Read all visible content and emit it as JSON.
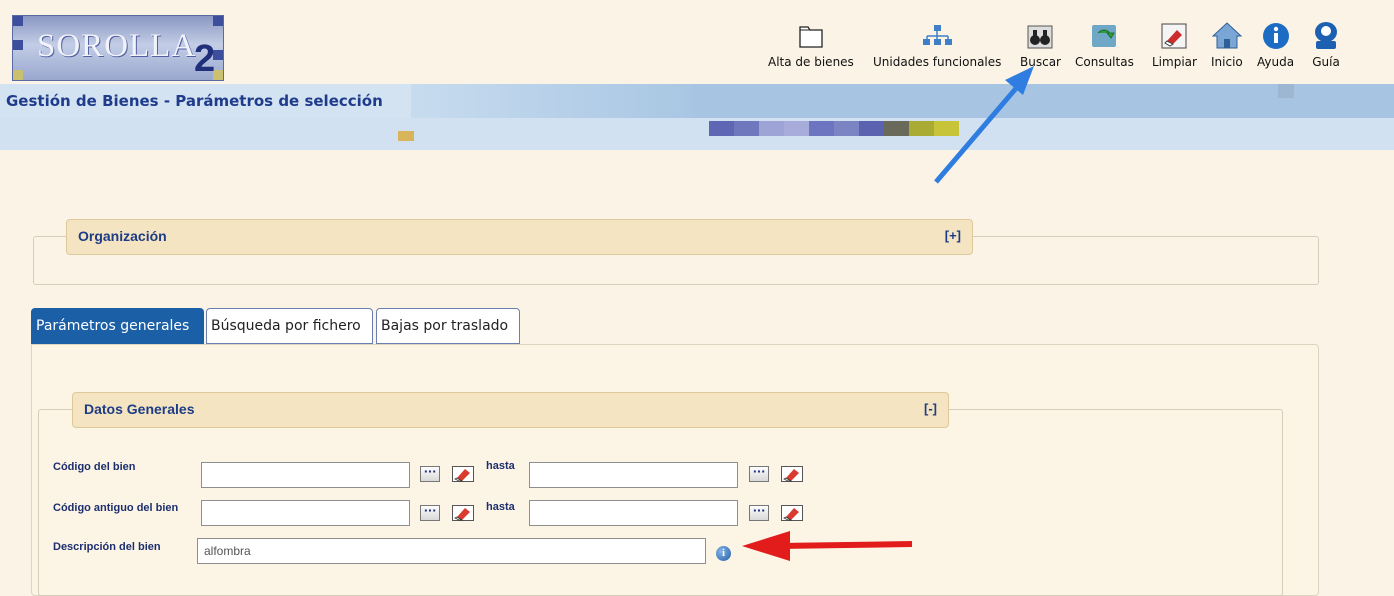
{
  "logo": {
    "text": "SOROLLA",
    "suffix": "2"
  },
  "toolbar": [
    {
      "id": "alta",
      "label": "Alta de bienes",
      "icon": "folder-icon"
    },
    {
      "id": "unidades",
      "label": "Unidades funcionales",
      "icon": "org-chart-icon"
    },
    {
      "id": "buscar",
      "label": "Buscar",
      "icon": "binoculars-icon"
    },
    {
      "id": "consultas",
      "label": "Consultas",
      "icon": "refresh-arrow-icon"
    },
    {
      "id": "limpiar",
      "label": "Limpiar",
      "icon": "eraser-icon"
    },
    {
      "id": "inicio",
      "label": "Inicio",
      "icon": "home-icon"
    },
    {
      "id": "ayuda",
      "label": "Ayuda",
      "icon": "info-icon"
    },
    {
      "id": "guia",
      "label": "Guía",
      "icon": "user-guide-icon"
    }
  ],
  "page_title": "Gestión de Bienes - Parámetros de selección",
  "organizacion": {
    "title": "Organización",
    "toggle": "[+]"
  },
  "tabs": [
    {
      "label": "Parámetros generales",
      "active": true
    },
    {
      "label": "Búsqueda por fichero",
      "active": false
    },
    {
      "label": "Bajas por traslado",
      "active": false
    }
  ],
  "datos_generales": {
    "title": "Datos Generales",
    "toggle": "[-]",
    "fields": {
      "codigo_bien": {
        "label": "Código del bien",
        "from": "",
        "hasta_label": "hasta",
        "to": ""
      },
      "codigo_antiguo": {
        "label": "Código antiguo del bien",
        "from": "",
        "hasta_label": "hasta",
        "to": ""
      },
      "descripcion": {
        "label": "Descripción del bien",
        "value": "alfombra"
      }
    },
    "lookup_button_label": "···"
  },
  "colors": {
    "accent_blue": "#1b5fa6",
    "title_blue": "#1f3c8c",
    "legend_bg": "#f5e4c1",
    "page_bg": "#fbf4e6",
    "arrow_blue": "#2f7de0",
    "arrow_red": "#e21b1b"
  }
}
